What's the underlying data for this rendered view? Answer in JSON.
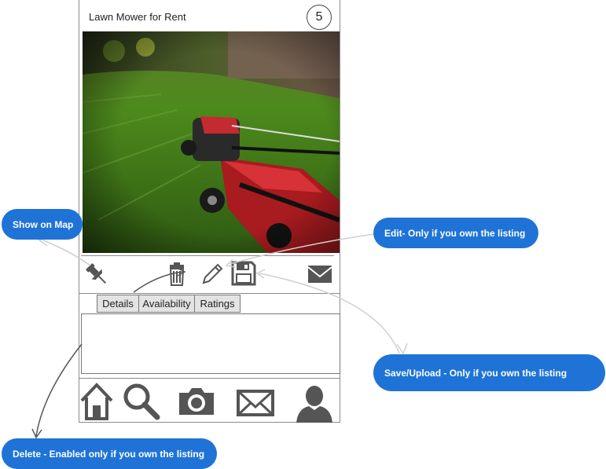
{
  "listing": {
    "title": "Lawn Mower for Rent",
    "count": "5"
  },
  "photo": {
    "alt": "Red lawn mower cutting grass"
  },
  "toolbar": {
    "icons": [
      "pin-icon",
      "trash-icon",
      "pencil-icon",
      "save-icon",
      "mail-icon"
    ]
  },
  "tabs": [
    "Details",
    "Availability",
    "Ratings"
  ],
  "bottom_nav": {
    "icons": [
      "home-icon",
      "search-icon",
      "camera-icon",
      "mail-icon",
      "profile-icon"
    ]
  },
  "annotations": {
    "show_on_map": "Show on Map",
    "edit": "Edit- Only if you own the listing",
    "save": "Save/Upload - Only if you own the listing",
    "delete": "Delete - Enabled only if you own the listing"
  },
  "colors": {
    "annotation_bubble": "#1f73d6",
    "icon_gray": "#555555",
    "tab_background": "#e3e3e3"
  }
}
